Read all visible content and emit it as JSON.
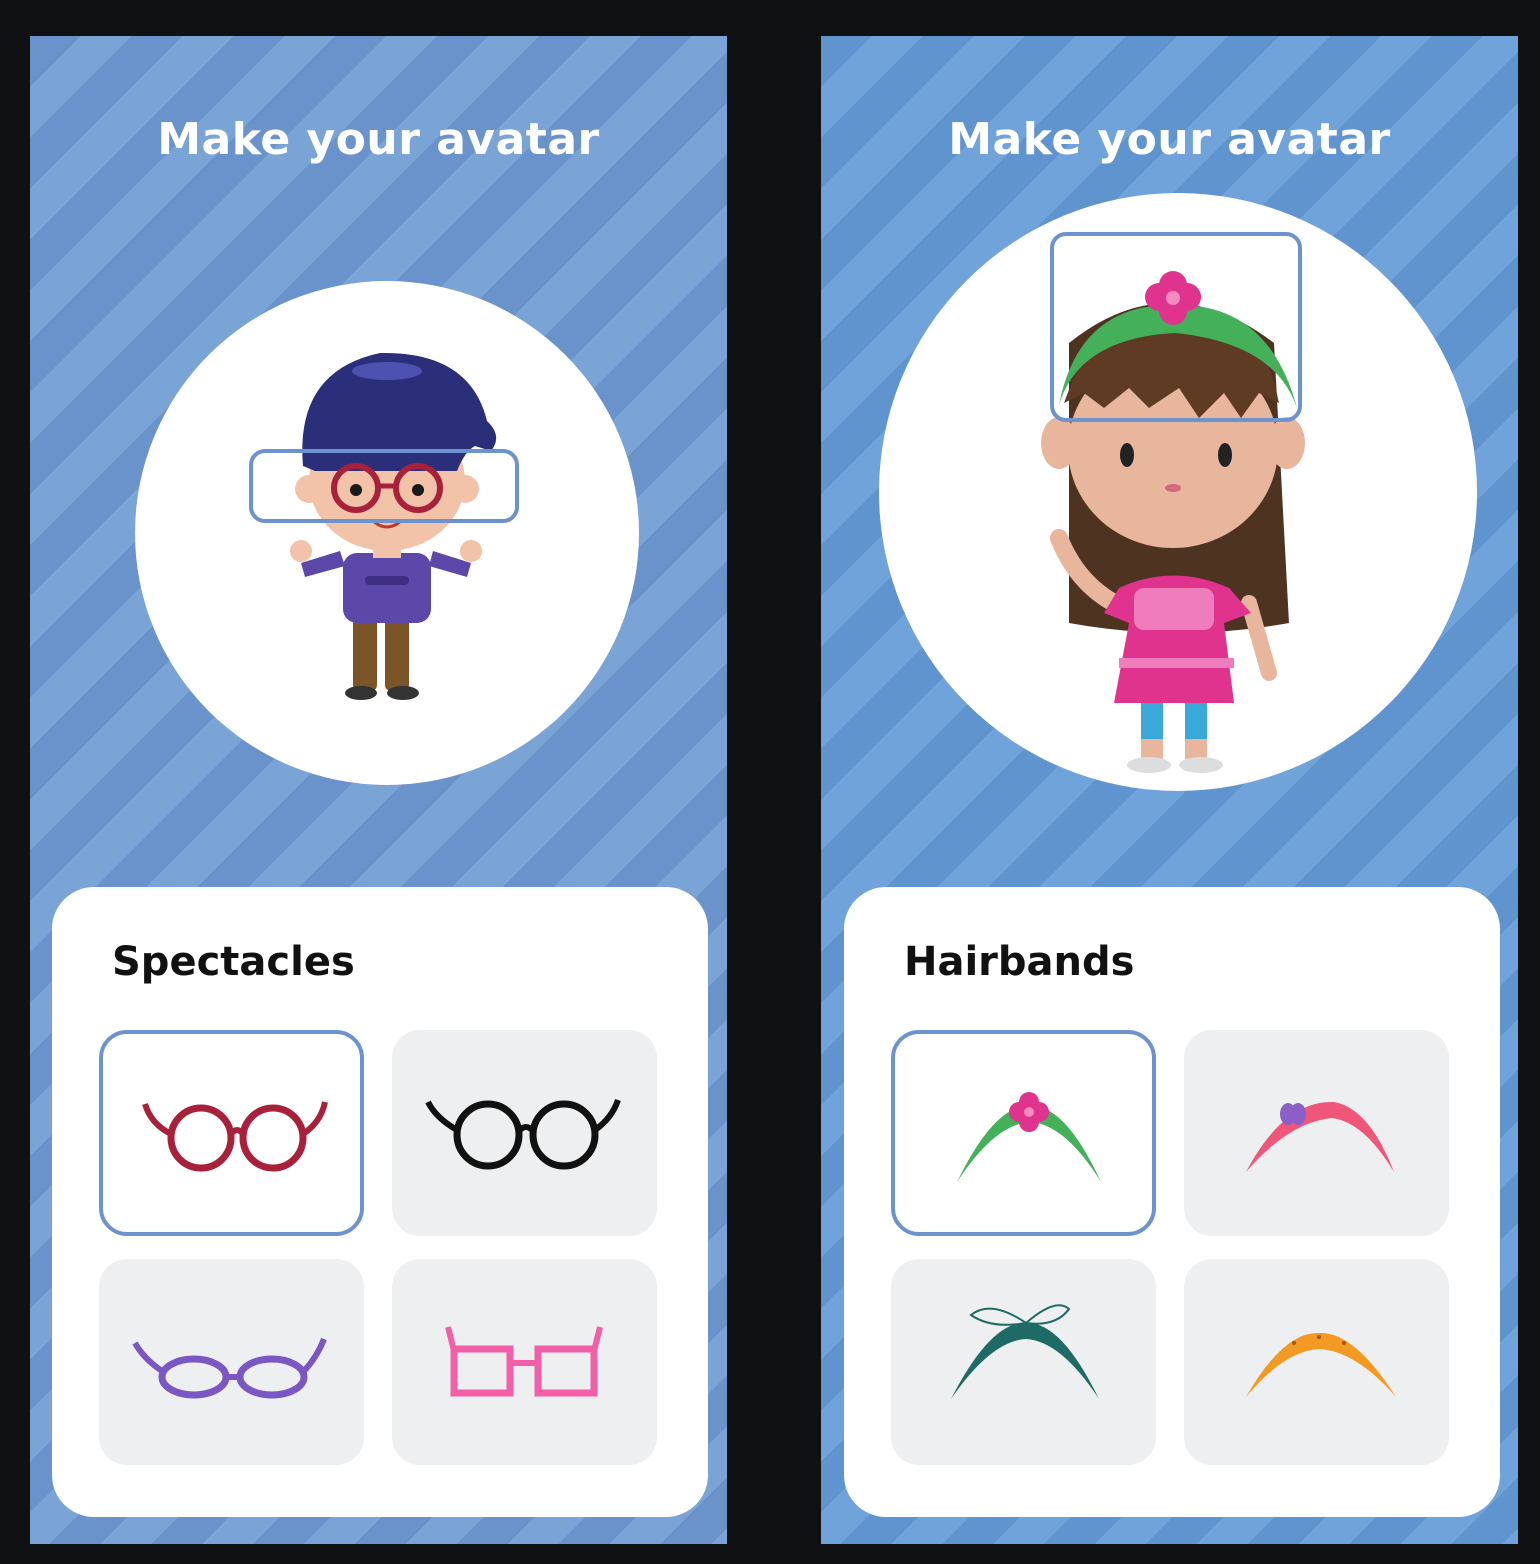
{
  "screens": [
    {
      "title": "Make your avatar",
      "category": "Spectacles",
      "options": [
        {
          "icon": "red-round-glasses-icon",
          "color": "#a8213a",
          "selected": true
        },
        {
          "icon": "black-round-glasses-icon",
          "color": "#111111",
          "selected": false
        },
        {
          "icon": "purple-oval-glasses-icon",
          "color": "#7a57c2",
          "selected": false
        },
        {
          "icon": "pink-square-glasses-icon",
          "color": "#f25fa6",
          "selected": false
        }
      ]
    },
    {
      "title": "Make your avatar",
      "category": "Hairbands",
      "options": [
        {
          "icon": "green-flower-hairband-icon",
          "color": "#45b05a",
          "selected": true
        },
        {
          "icon": "pink-bow-hairband-icon",
          "color": "#f0567a",
          "selected": false
        },
        {
          "icon": "teal-ribbon-hairband-icon",
          "color": "#1e6b66",
          "selected": false
        },
        {
          "icon": "orange-hairband-icon",
          "color": "#f39a25",
          "selected": false
        }
      ]
    }
  ],
  "colors": {
    "accent": "#6d93cf",
    "background": "#101112",
    "panel": "#ffffff",
    "option_bg": "#eeeff0"
  }
}
